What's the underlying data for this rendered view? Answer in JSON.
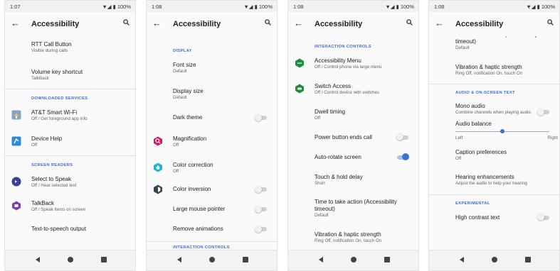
{
  "icons": {
    "back": "arrow-left",
    "search": "search",
    "nav_back": "triangle-left",
    "nav_home": "circle",
    "nav_recent": "square"
  },
  "colors": {
    "accent": "#3b6fd4",
    "toggle_on": "#3b6fd4",
    "toggle_off": "#cfcfcf"
  },
  "screens": [
    {
      "status": {
        "time": "1:07",
        "system": "▼◢ ▮ 100%"
      },
      "title": "Accessibility",
      "rtt": {
        "title": "RTT Call Button",
        "subtitle": "Visible during calls"
      },
      "volume": {
        "title": "Volume key shortcut",
        "subtitle": "TalkBack"
      },
      "downloaded_header": "DOWNLOADED SERVICES",
      "wifi": {
        "title": "AT&T Smart Wi-Fi",
        "subtitle": "Off / Get foreground app info"
      },
      "device_help": {
        "title": "Device Help",
        "subtitle": "Off"
      },
      "screen_readers_header": "SCREEN READERS",
      "select_to_speak": {
        "title": "Select to Speak",
        "subtitle": "Off / Hear selected text"
      },
      "talkback": {
        "title": "TalkBack",
        "subtitle": "Off / Speak items on screen"
      },
      "tts": {
        "title": "Text-to-speech output"
      }
    },
    {
      "status": {
        "time": "1:08",
        "system": "▼◢ ▮ 100%"
      },
      "title": "Accessibility",
      "display_header": "DISPLAY",
      "font_size": {
        "title": "Font size",
        "subtitle": "Default"
      },
      "display_size": {
        "title": "Display size",
        "subtitle": "Default"
      },
      "dark_theme": {
        "title": "Dark theme",
        "on": false
      },
      "magnification": {
        "title": "Magnification",
        "subtitle": "Off"
      },
      "color_correction": {
        "title": "Color correction",
        "subtitle": "Off"
      },
      "color_inversion": {
        "title": "Color inversion",
        "on": false
      },
      "large_pointer": {
        "title": "Large mouse pointer",
        "on": false
      },
      "remove_animations": {
        "title": "Remove animations",
        "on": false
      },
      "interaction_header": "INTERACTION CONTROLS"
    },
    {
      "status": {
        "time": "1:08",
        "system": "▼◢ ▮ 100%"
      },
      "title": "Accessibility",
      "interaction_header": "INTERACTION CONTROLS",
      "accessibility_menu": {
        "title": "Accessibility Menu",
        "subtitle": "Off / Control phone via large menu"
      },
      "switch_access": {
        "title": "Switch Access",
        "subtitle": "Off / Control device with switches"
      },
      "dwell_timing": {
        "title": "Dwell timing",
        "subtitle": "Off"
      },
      "power_button": {
        "title": "Power button ends call",
        "on": false
      },
      "auto_rotate": {
        "title": "Auto-rotate screen",
        "on": true
      },
      "touch_hold": {
        "title": "Touch & hold delay",
        "subtitle": "Short"
      },
      "time_to_act": {
        "title": "Time to take action (Accessibility timeout)",
        "subtitle": "Default"
      },
      "vibration": {
        "title": "Vibration & haptic strength",
        "subtitle": "Ring Off, notification On, touch On"
      }
    },
    {
      "status": {
        "time": "1:08",
        "system": "▼◢ ▮ 100%"
      },
      "title": "Accessibility",
      "time_to_act": {
        "title": "Time to take action (Accessibility timeout)",
        "subtitle": "Default"
      },
      "vibration": {
        "title": "Vibration & haptic strength",
        "subtitle": "Ring Off, notification On, touch On"
      },
      "audio_header": "AUDIO & ON-SCREEN TEXT",
      "mono_audio": {
        "title": "Mono audio",
        "subtitle": "Combine channels when playing audio",
        "on": false
      },
      "audio_balance": {
        "title": "Audio balance",
        "left": "Left",
        "right": "Right",
        "value": 0.5
      },
      "caption": {
        "title": "Caption preferences",
        "subtitle": "Off"
      },
      "hearing": {
        "title": "Hearing enhancements",
        "subtitle": "Adjust the audio to help your hearing"
      },
      "experimental_header": "EXPERIMENTAL",
      "high_contrast": {
        "title": "High contrast text",
        "on": false
      }
    }
  ]
}
